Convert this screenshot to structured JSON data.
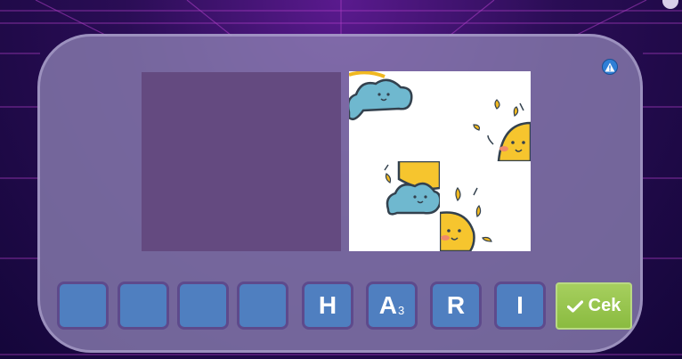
{
  "colors": {
    "panel": "#8c80b2",
    "dropzone": "#644a80",
    "slot": "#4f7fc0",
    "check": "#8abb40",
    "warning": "#2f7fd6"
  },
  "icons": {
    "warning": "warning-icon",
    "check": "checkmark-icon",
    "tiles": [
      "cloud-sun-tile",
      "sun-tile",
      "cloud-sun-tile",
      "sun-tile"
    ]
  },
  "answer_slots": [
    {
      "letter": "",
      "sub": ""
    },
    {
      "letter": "",
      "sub": ""
    },
    {
      "letter": "",
      "sub": ""
    },
    {
      "letter": "",
      "sub": ""
    },
    {
      "letter": "H",
      "sub": ""
    },
    {
      "letter": "A",
      "sub": "3"
    },
    {
      "letter": "R",
      "sub": ""
    },
    {
      "letter": "I",
      "sub": ""
    }
  ],
  "check_button": {
    "label": "Cek"
  }
}
